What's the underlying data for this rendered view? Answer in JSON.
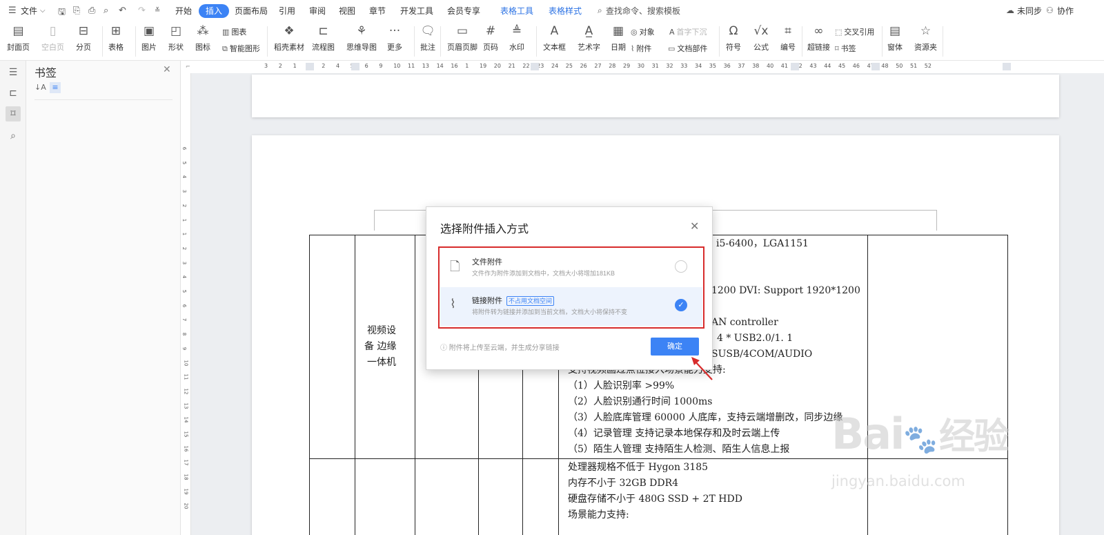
{
  "menubar": {
    "file_label": "文件",
    "tabs": [
      "开始",
      "插入",
      "页面布局",
      "引用",
      "审阅",
      "视图",
      "章节",
      "开发工具",
      "会员专享",
      "表格工具",
      "表格样式"
    ],
    "search_placeholder": "查找命令、搜索模板",
    "sync_label": "未同步",
    "collab_label": "协作"
  },
  "ribbon": {
    "buttons": [
      "封面页",
      "空白页",
      "分页",
      "表格",
      "图片",
      "形状",
      "图标",
      "稻壳素材",
      "流程图",
      "思维导图",
      "更多",
      "批注",
      "页眉页脚",
      "页码",
      "水印",
      "文本框",
      "艺术字",
      "日期",
      "符号",
      "公式",
      "编号",
      "超链接",
      "窗体",
      "资源夹"
    ],
    "small": {
      "chart": "图表",
      "smart_shape": "智能图形",
      "object": "对象",
      "drop_cap": "首字下沉",
      "attachment": "附件",
      "doc_part": "文档部件",
      "cross_ref": "交叉引用",
      "bookmark": "书签"
    }
  },
  "panel": {
    "title": "书签"
  },
  "ruler": {
    "h_ticks": [
      "3",
      "2",
      "1",
      "1",
      "2",
      "4",
      "5",
      "6",
      "9",
      "10",
      "11",
      "13",
      "14",
      "16",
      "1",
      "19",
      "20",
      "21",
      "22",
      "23",
      "24",
      "25",
      "26",
      "27",
      "28",
      "29",
      "30",
      "31",
      "32",
      "33",
      "34",
      "35",
      "36",
      "37",
      "38",
      "40",
      "41",
      "42",
      "43",
      "44",
      "45",
      "46",
      "47",
      "48",
      "50",
      "51",
      "52"
    ],
    "v_ticks": [
      "6",
      "5",
      "4",
      "3",
      "2",
      "1",
      "1",
      "2",
      "3",
      "4",
      "5",
      "6",
      "7",
      "8",
      "9",
      "10",
      "11",
      "12",
      "13",
      "14",
      "15",
      "16",
      "17",
      "18",
      "19",
      "20"
    ]
  },
  "table": {
    "cell_device": [
      "视频设",
      "备 边缘",
      "一体机"
    ],
    "row1_lines": [
      "i5-6400，LGA1151",
      "1200 DVI: Support 1920*1200",
      "AN controller",
      "4 * USB2.0/1. 1",
      "SUSB/4COM/AUDIO",
      "支持视频画过点位接入场景能力支持:",
      "（1）人脸识别率 >99%",
      "（2）人脸识别通行时间 1000ms",
      "（3）人脸底库管理 60000 人底库，支持云端增删改，同步边缘",
      "（4）记录管理 支持记录本地保存和及时云端上传",
      "（5）陌生人管理 支持陌生人检测、陌生人信息上报"
    ],
    "row2_lines": [
      "处理器规格不低于 Hygon 3185",
      "内存不小于 32GB DDR4",
      "硬盘存储不小于 480G SSD + 2T HDD",
      "场景能力支持:"
    ]
  },
  "dialog": {
    "title": "选择附件插入方式",
    "option1": {
      "title": "文件附件",
      "desc": "文件作为附件添加到文档中，文档大小将增加181KB"
    },
    "option2": {
      "title": "链接附件",
      "tag": "不占用文档空间",
      "desc": "将附件转为链接并添加到当前文档，文档大小将保持不变"
    },
    "selected": "链接附件",
    "note": "附件将上传至云端，并生成分享链接",
    "ok": "确定"
  },
  "watermark": {
    "brand": "Bai",
    "brand2": "经验",
    "url": "jingyan.baidu.com"
  }
}
